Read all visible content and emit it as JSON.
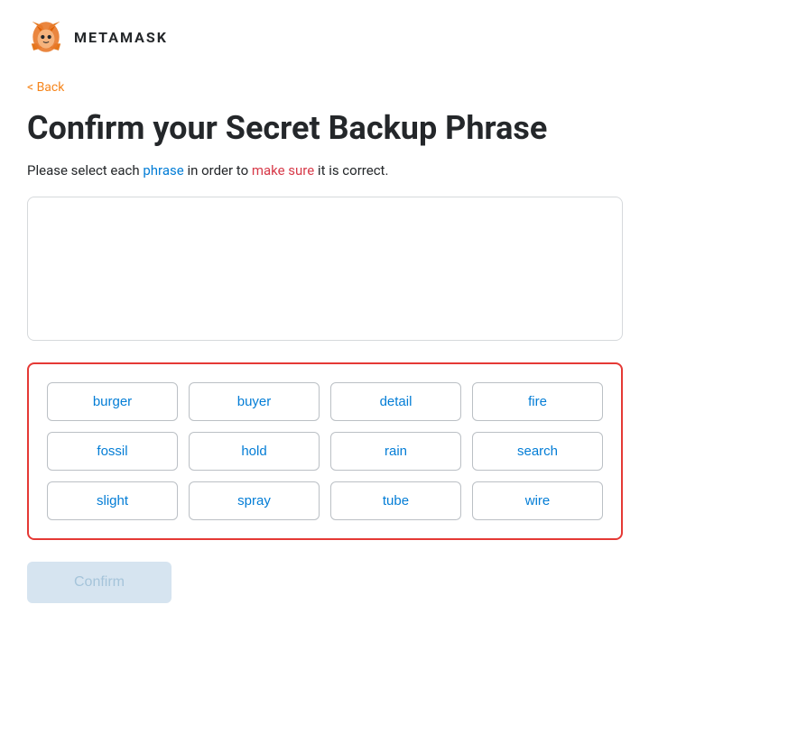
{
  "header": {
    "brand": "METAMASK"
  },
  "back_link": "< Back",
  "page_title": "Confirm your Secret Backup Phrase",
  "subtitle": {
    "part1": "Please select each ",
    "word1": "phrase",
    "part2": " in order to ",
    "word2": "make sure",
    "part3": " it is correct."
  },
  "word_grid": {
    "words": [
      "burger",
      "buyer",
      "detail",
      "fire",
      "fossil",
      "hold",
      "rain",
      "search",
      "slight",
      "spray",
      "tube",
      "wire"
    ]
  },
  "confirm_button_label": "Confirm"
}
